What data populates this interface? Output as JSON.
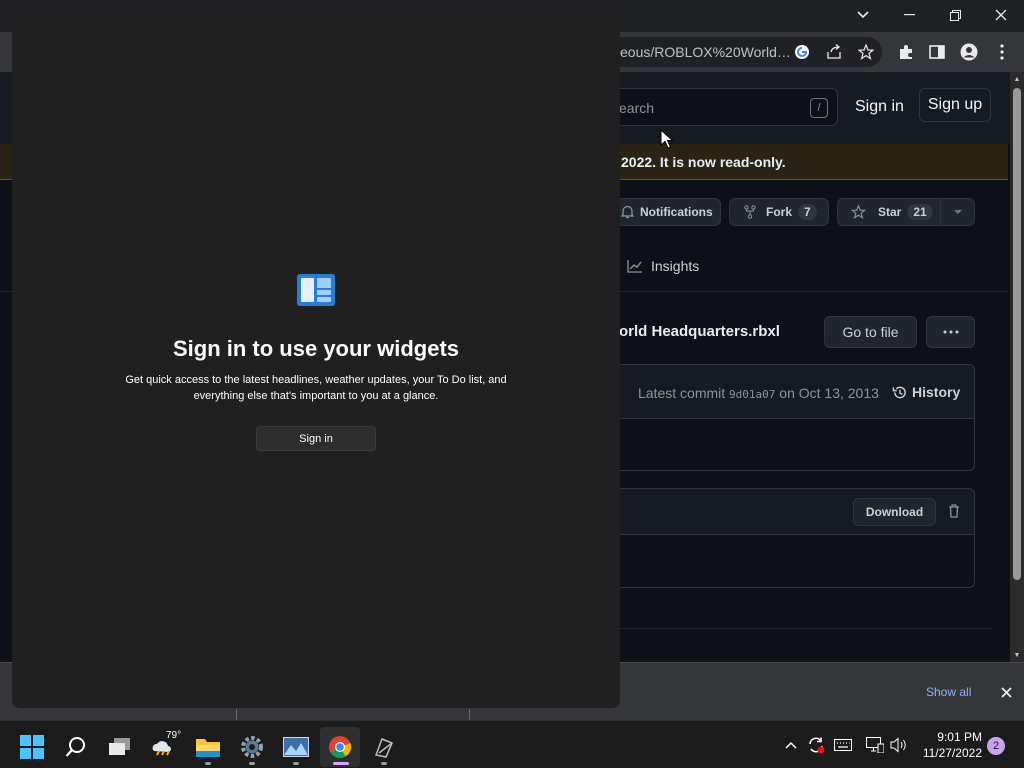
{
  "browser": {
    "url": "eous/ROBLOX%20World…",
    "colors": {
      "tabstrip": "#202124",
      "toolbar": "#35363a"
    }
  },
  "github": {
    "search_placeholder": "earch",
    "search_shortcut": "/",
    "sign_in": "Sign in",
    "sign_up": "Sign up",
    "banner": "2022. It is now read-only.",
    "notifications_label": "Notifications",
    "fork_label": "Fork",
    "fork_count": "7",
    "star_label": "Star",
    "star_count": "21",
    "insights_tab": "Insights",
    "file_name": "orld Headquarters.rbxl",
    "go_to_file": "Go to file",
    "latest_commit_prefix": "Latest commit",
    "commit_sha": "9d01a07",
    "commit_date": "on Oct 13, 2013",
    "history_label": "History",
    "download_label": "Download",
    "colors": {
      "bg": "#0d1117",
      "header": "#161b22",
      "border": "#30363d",
      "banner": "#2b2414"
    }
  },
  "downloads_bar": {
    "show_all": "Show all"
  },
  "widgets": {
    "title": "Sign in to use your widgets",
    "description_line1": "Get quick access to the latest headlines, weather updates, your To Do list, and",
    "description_line2": "everything else that's important to you at a glance.",
    "sign_in_button": "Sign in",
    "colors": {
      "panel": "#202020",
      "icon_blue": "#2b7cd3"
    }
  },
  "taskbar": {
    "weather_temp": "79°",
    "clock_time": "9:01 PM",
    "clock_date": "11/27/2022",
    "notification_count": "2",
    "items": [
      {
        "name": "start-icon"
      },
      {
        "name": "search-icon"
      },
      {
        "name": "task-view-icon"
      },
      {
        "name": "weather-icon"
      },
      {
        "name": "file-explorer-icon"
      },
      {
        "name": "settings-icon"
      },
      {
        "name": "photos-icon"
      },
      {
        "name": "chrome-icon"
      },
      {
        "name": "roblox-studio-icon"
      }
    ]
  }
}
